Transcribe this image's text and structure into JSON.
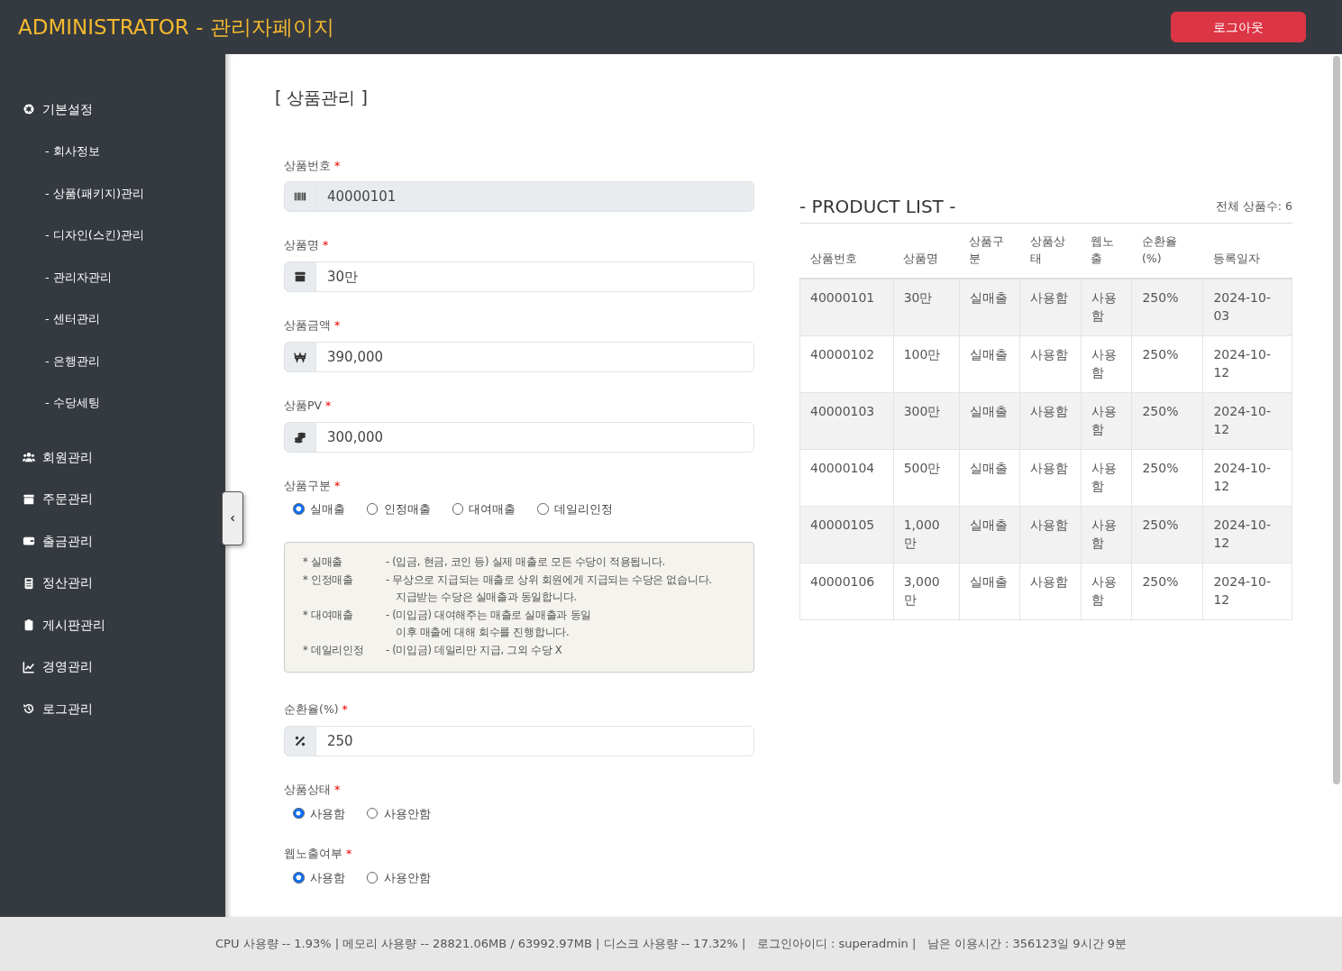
{
  "header": {
    "title": "ADMINISTRATOR - 관리자페이지",
    "logout": "로그아웃"
  },
  "sidebar": {
    "items": [
      {
        "label": "기본설정",
        "children": [
          {
            "label": "- 회사정보"
          },
          {
            "label": "- 상품(패키지)관리"
          },
          {
            "label": "- 디자인(스킨)관리"
          },
          {
            "label": "- 관리자관리"
          },
          {
            "label": "- 센터관리"
          },
          {
            "label": "- 은행관리"
          },
          {
            "label": "- 수당세팅"
          }
        ]
      },
      {
        "label": "회원관리"
      },
      {
        "label": "주문관리"
      },
      {
        "label": "출금관리"
      },
      {
        "label": "정산관리"
      },
      {
        "label": "게시판관리"
      },
      {
        "label": "경영관리"
      },
      {
        "label": "로그관리"
      }
    ]
  },
  "page_title": "[ 상품관리 ]",
  "form": {
    "fields": [
      {
        "kind": "input",
        "label": "상품번호",
        "mark": "*",
        "value": "40000101",
        "disabled": true
      },
      {
        "kind": "input",
        "label": "상품명",
        "mark": "*",
        "value": "30만",
        "disabled": false
      },
      {
        "kind": "input",
        "label": "상품금액",
        "mark": "*",
        "value": "390,000",
        "disabled": false
      },
      {
        "kind": "input",
        "label": "상품PV",
        "mark": "*",
        "value": "300,000",
        "disabled": false
      },
      {
        "kind": "radio",
        "label": "상품구분",
        "mark": "*",
        "options": [
          {
            "label": "실매출",
            "selected": true
          },
          {
            "label": "인정매출",
            "selected": false
          },
          {
            "label": "대여매출",
            "selected": false
          },
          {
            "label": "데일리인정",
            "selected": false
          }
        ]
      },
      {
        "kind": "info",
        "lines": [
          {
            "term": "* 실매출",
            "desc": [
              "- (입금, 현금, 코인 등) 실제 매출로 모든 수당이 적용됩니다."
            ]
          },
          {
            "term": "* 인정매출",
            "desc": [
              "- 무상으로 지급되는 매출로 상위 회원에게 지급되는 수당은 없습니다.",
              "지급받는 수당은 실매출과 동일합니다."
            ]
          },
          {
            "term": "* 대여매출",
            "desc": [
              "- (미입금) 대여해주는 매출로 실매출과 동일",
              "이후 매출에 대해 회수를 진행합니다."
            ]
          },
          {
            "term": "* 데일리인정",
            "desc": [
              "- (미입금) 데일리만 지급, 그외 수당 X"
            ]
          }
        ]
      },
      {
        "kind": "input",
        "label": "순환율(%)",
        "mark": "*",
        "value": "250",
        "disabled": false
      },
      {
        "kind": "radio",
        "label": "상품상태",
        "mark": "*",
        "options": [
          {
            "label": "사용함",
            "selected": true
          },
          {
            "label": "사용안함",
            "selected": false
          }
        ]
      },
      {
        "kind": "radio",
        "label": "웹노출여부",
        "mark": "*",
        "options": [
          {
            "label": "사용함",
            "selected": true
          },
          {
            "label": "사용안함",
            "selected": false
          }
        ]
      }
    ]
  },
  "product_list": {
    "title": "- PRODUCT LIST -",
    "total": "전체 상품수: 6",
    "columns": [
      "상품번호",
      "상품명",
      "상품구분",
      "상품상태",
      "웹노출",
      "순환율(%)",
      "등록일자"
    ],
    "rows": [
      [
        "40000101",
        "30만",
        "실매출",
        "사용함",
        "사용함",
        "250%",
        "2024-10-03"
      ],
      [
        "40000102",
        "100만",
        "실매출",
        "사용함",
        "사용함",
        "250%",
        "2024-10-12"
      ],
      [
        "40000103",
        "300만",
        "실매출",
        "사용함",
        "사용함",
        "250%",
        "2024-10-12"
      ],
      [
        "40000104",
        "500만",
        "실매출",
        "사용함",
        "사용함",
        "250%",
        "2024-10-12"
      ],
      [
        "40000105",
        "1,000만",
        "실매출",
        "사용함",
        "사용함",
        "250%",
        "2024-10-12"
      ],
      [
        "40000106",
        "3,000만",
        "실매출",
        "사용함",
        "사용함",
        "250%",
        "2024-10-12"
      ]
    ]
  },
  "status_bar": "CPU 사용량 -- 1.93% | 메모리 사용량 -- 28821.06MB / 63992.97MB | 디스크 사용량 -- 17.32% |   로그인아이디 : superadmin |   남은 이용시간 : 356123일 9시간 9분"
}
